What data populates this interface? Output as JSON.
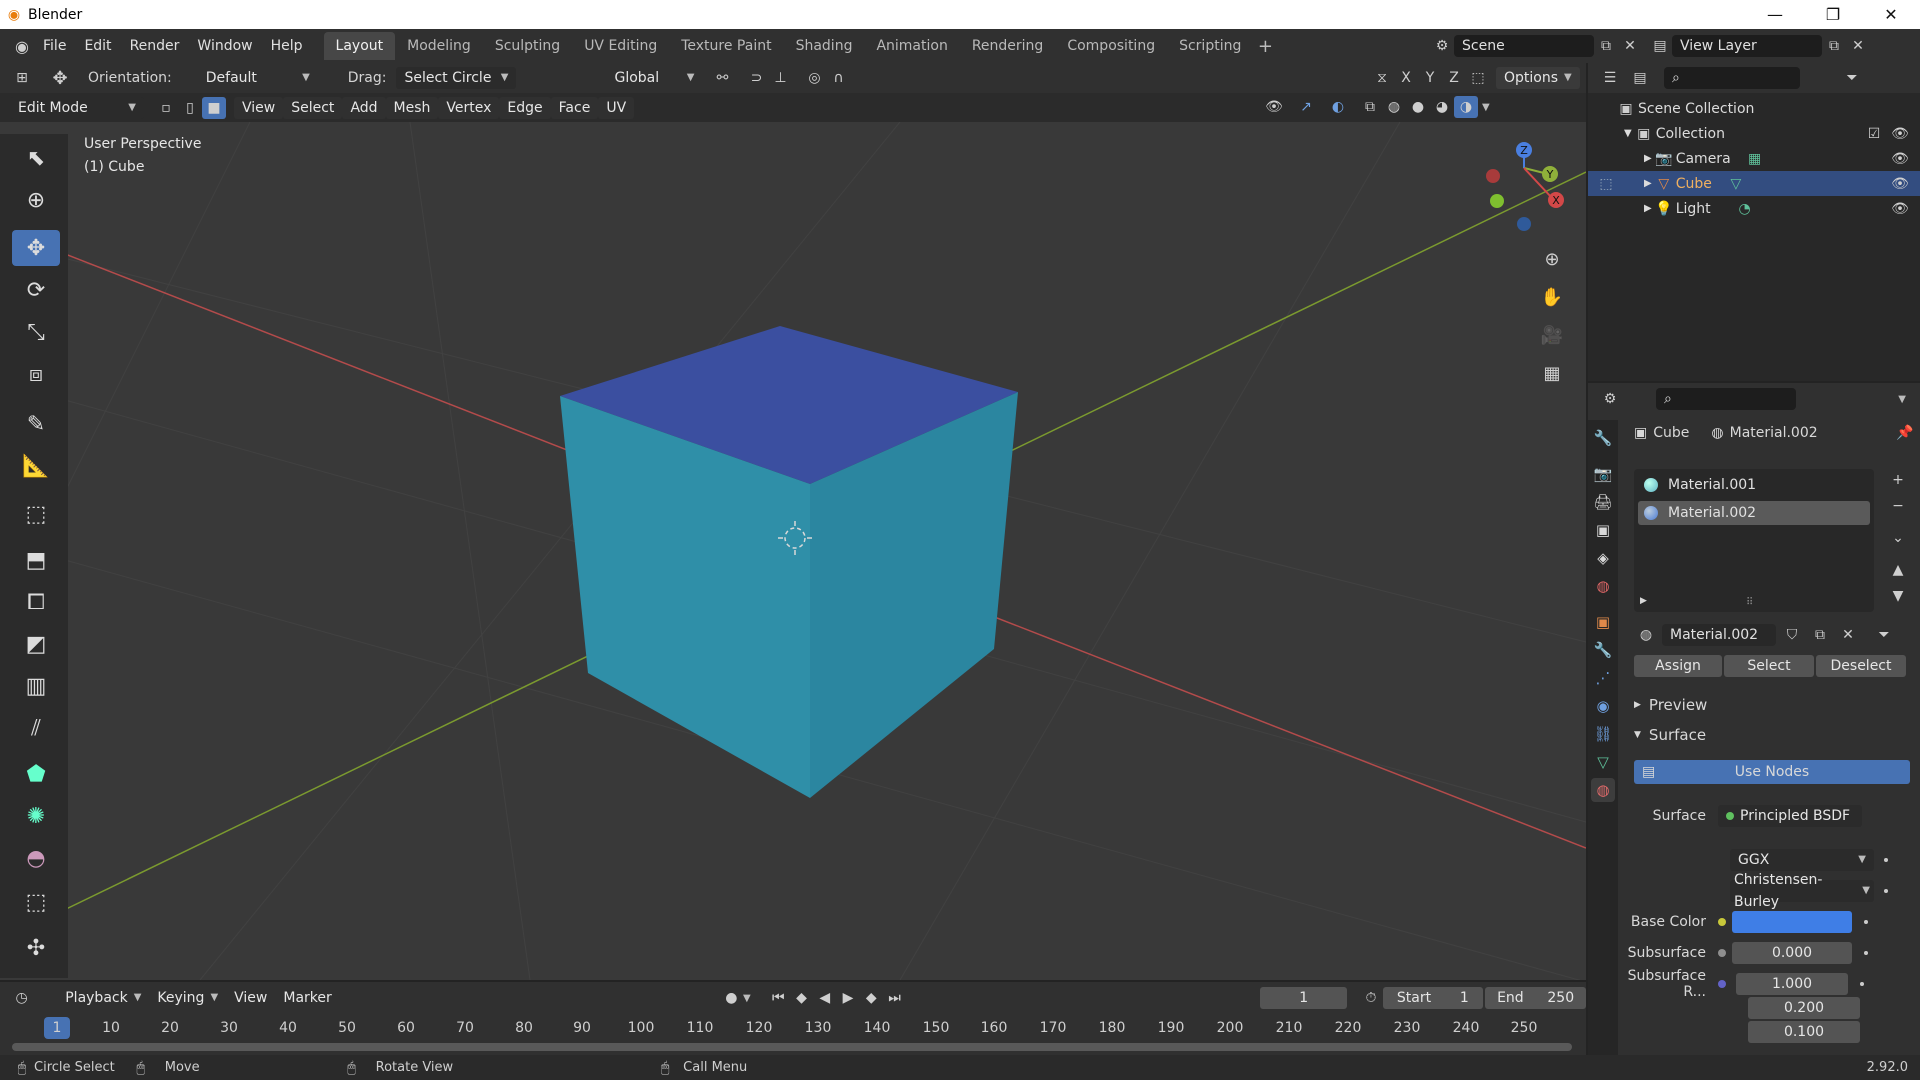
{
  "window": {
    "title": "Blender",
    "min": "—",
    "max": "❐",
    "close": "✕"
  },
  "menu": [
    "File",
    "Edit",
    "Render",
    "Window",
    "Help"
  ],
  "workspaces": [
    "Layout",
    "Modeling",
    "Sculpting",
    "UV Editing",
    "Texture Paint",
    "Shading",
    "Animation",
    "Rendering",
    "Compositing",
    "Scripting"
  ],
  "scene": {
    "name": "Scene",
    "view_layer": "View Layer"
  },
  "tool_header": {
    "orientation_label": "Orientation:",
    "orientation_value": "Default",
    "drag_label": "Drag:",
    "drag_value": "Select Circle",
    "transform_orientation": "Global",
    "axes": [
      "X",
      "Y",
      "Z"
    ],
    "options": "Options"
  },
  "view_header": {
    "mode": "Edit Mode",
    "menus": [
      "View",
      "Select",
      "Add",
      "Mesh",
      "Vertex",
      "Edge",
      "Face",
      "UV"
    ]
  },
  "viewport": {
    "perspective": "User Perspective",
    "object": "(1) Cube",
    "gizmo_axes": [
      "Z",
      "Y",
      "X"
    ]
  },
  "outliner": {
    "root": "Scene Collection",
    "collection": "Collection",
    "items": [
      {
        "name": "Camera",
        "selected": false
      },
      {
        "name": "Cube",
        "selected": true
      },
      {
        "name": "Light",
        "selected": false
      }
    ]
  },
  "properties": {
    "breadcrumb_object": "Cube",
    "breadcrumb_material": "Material.002",
    "materials": [
      {
        "name": "Material.001",
        "color": "#5fb3c4",
        "selected": false
      },
      {
        "name": "Material.002",
        "color": "#4a7bd6",
        "selected": true
      }
    ],
    "active_material": "Material.002",
    "assign": "Assign",
    "select": "Select",
    "deselect": "Deselect",
    "panel_preview": "Preview",
    "panel_surface": "Surface",
    "use_nodes": "Use Nodes",
    "surface_label": "Surface",
    "surface_value": "Principled BSDF",
    "distribution": "GGX",
    "subsurface_method": "Christensen-Burley",
    "base_color_label": "Base Color",
    "base_color": "#3f7ee6",
    "subsurface_label": "Subsurface",
    "subsurface_value": "0.000",
    "subsurface_radius_label": "Subsurface R...",
    "subsurface_radius": [
      "1.000",
      "0.200",
      "0.100"
    ]
  },
  "timeline": {
    "menus": [
      "Playback",
      "Keying",
      "View",
      "Marker"
    ],
    "current_frame": "1",
    "start_label": "Start",
    "start": "1",
    "end_label": "End",
    "end": "250",
    "ruler": [
      "1",
      "10",
      "20",
      "30",
      "40",
      "50",
      "60",
      "70",
      "80",
      "90",
      "100",
      "110",
      "120",
      "130",
      "140",
      "150",
      "160",
      "170",
      "180",
      "190",
      "200",
      "210",
      "220",
      "230",
      "240",
      "250"
    ]
  },
  "statusbar": {
    "circle_select": "Circle Select",
    "move": "Move",
    "rotate_view": "Rotate View",
    "call_menu": "Call Menu",
    "version": "2.92.0"
  },
  "colors": {
    "accent": "#4772b3",
    "cube_top": "#3b4fa0",
    "cube_side": "#2f8fa8",
    "selected_row": "#334d80"
  }
}
